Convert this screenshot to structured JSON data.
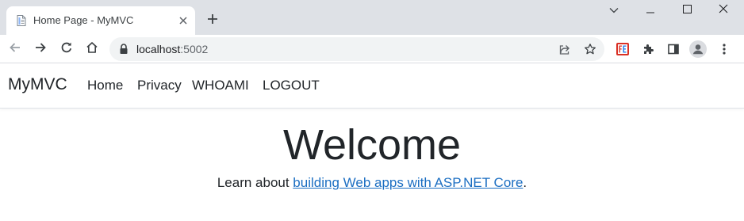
{
  "tab": {
    "title": "Home Page - MyMVC",
    "favicon_icon": "page-icon",
    "close_icon": "close-icon"
  },
  "tabstrip": {
    "new_tab_icon": "plus-icon",
    "window_controls": [
      "chevron-down-icon",
      "minimize-icon",
      "maximize-icon",
      "close-icon"
    ]
  },
  "toolbar": {
    "back_icon": "arrow-left-icon",
    "forward_icon": "arrow-right-icon",
    "reload_icon": "reload-icon",
    "home_icon": "home-icon",
    "url_host": "localhost",
    "url_port": ":5002",
    "share_icon": "share-icon",
    "bookmark_icon": "star-icon",
    "extensions": [
      "fe-extension-icon",
      "puzzle-icon",
      "sidepanel-icon",
      "profile-icon",
      "kebab-menu-icon"
    ]
  },
  "site": {
    "brand": "MyMVC",
    "nav": [
      {
        "label": "Home"
      },
      {
        "label": "Privacy"
      },
      {
        "label": "WHOAMI"
      },
      {
        "label": "LOGOUT"
      }
    ],
    "heading": "Welcome",
    "lead_prefix": "Learn about ",
    "lead_link": "building Web apps with ASP.NET Core",
    "lead_suffix": "."
  },
  "colors": {
    "tabstrip_bg": "#dee1e6",
    "omnibox_bg": "#f1f3f4",
    "link": "#1b6ec2",
    "text": "#212529",
    "fe_badge": "#d93025"
  }
}
